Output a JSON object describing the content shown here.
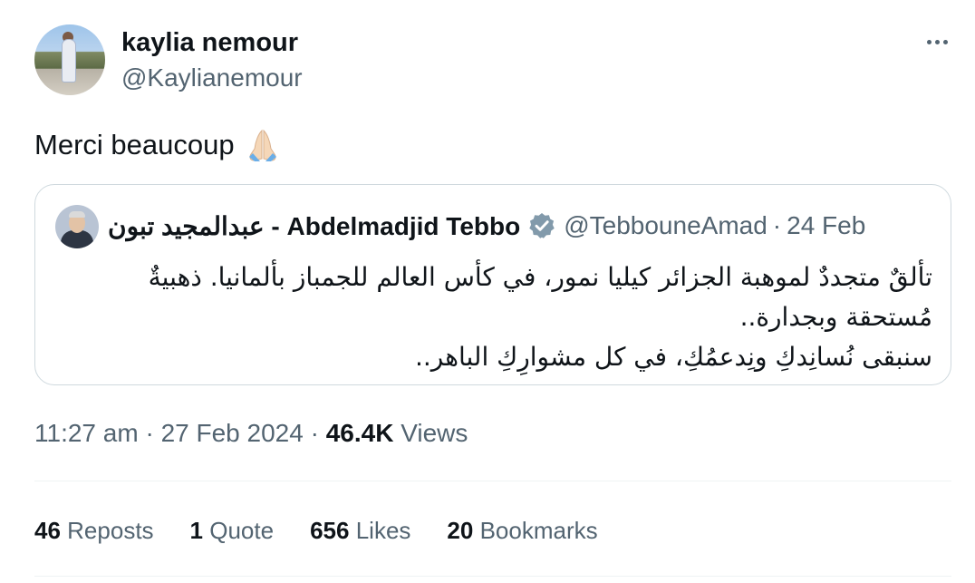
{
  "author": {
    "display_name": "kaylia nemour",
    "handle": "@Kaylianemour"
  },
  "tweet": {
    "text": "Merci beaucoup",
    "emoji_icon": "folded-hands-icon"
  },
  "quoted_tweet": {
    "display_name": "عبدالمجيد تبون - Abdelmadjid Tebbo",
    "verified_icon": "verified-badge-icon",
    "handle": "@TebbouneAmad",
    "separator": "·",
    "date": "24 Feb",
    "lines": [
      "تألقٌ متجددٌ لموهبة الجزائر كيليا نمور، في كأس العالم للجمباز بألمانيا. ذهبيةٌ",
      "مُستحقة وبجدارة..",
      "سنبقى نُسانِدكِ ونِدعمُكِ، في كل مشوارِكِ الباهر.."
    ]
  },
  "meta": {
    "time": "11:27 am",
    "separator": "·",
    "date": "27 Feb 2024",
    "views_count": "46.4K",
    "views_label": "Views"
  },
  "stats": {
    "reposts_count": "46",
    "reposts_label": "Reposts",
    "quotes_count": "1",
    "quotes_label": "Quote",
    "likes_count": "656",
    "likes_label": "Likes",
    "bookmarks_count": "20",
    "bookmarks_label": "Bookmarks"
  },
  "colors": {
    "text": "#0f1419",
    "secondary": "#536471",
    "border": "#cfd9de",
    "verified": "#829aab"
  }
}
